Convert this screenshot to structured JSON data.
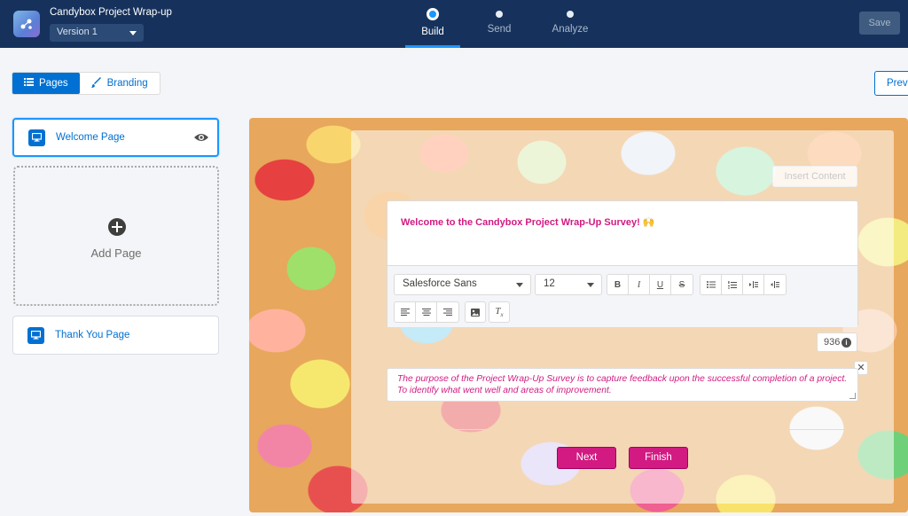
{
  "header": {
    "app_title": "Candybox Project Wrap-up",
    "version": "Version 1",
    "steps": [
      {
        "label": "Build",
        "active": true
      },
      {
        "label": "Send",
        "active": false
      },
      {
        "label": "Analyze",
        "active": false
      }
    ],
    "save_label": "Save"
  },
  "toolbar": {
    "tabs": [
      {
        "label": "Pages",
        "icon": "list-icon",
        "active": true
      },
      {
        "label": "Branding",
        "icon": "brush-icon",
        "active": false
      }
    ],
    "preview_label": "Previ"
  },
  "sidebar": {
    "pages": [
      {
        "label": "Welcome Page",
        "icon": "monitor-icon",
        "selected": true
      },
      {
        "label": "Thank You Page",
        "icon": "monitor-icon",
        "selected": false
      }
    ],
    "add_page_label": "Add Page"
  },
  "canvas": {
    "insert_content_label": "Insert Content",
    "welcome_text": "Welcome to the Candybox Project Wrap-Up Survey! 🙌",
    "font_family": "Salesforce Sans",
    "font_size": "12",
    "char_count": "936",
    "description": "The purpose of the Project Wrap-Up Survey is to capture feedback upon the successful completion of a project. To identify what went well and areas of improvement.",
    "next_label": "Next",
    "finish_label": "Finish"
  },
  "colors": {
    "header_bg": "#16325c",
    "brand_blue": "#0070d2",
    "accent_pink": "#d21a82"
  }
}
